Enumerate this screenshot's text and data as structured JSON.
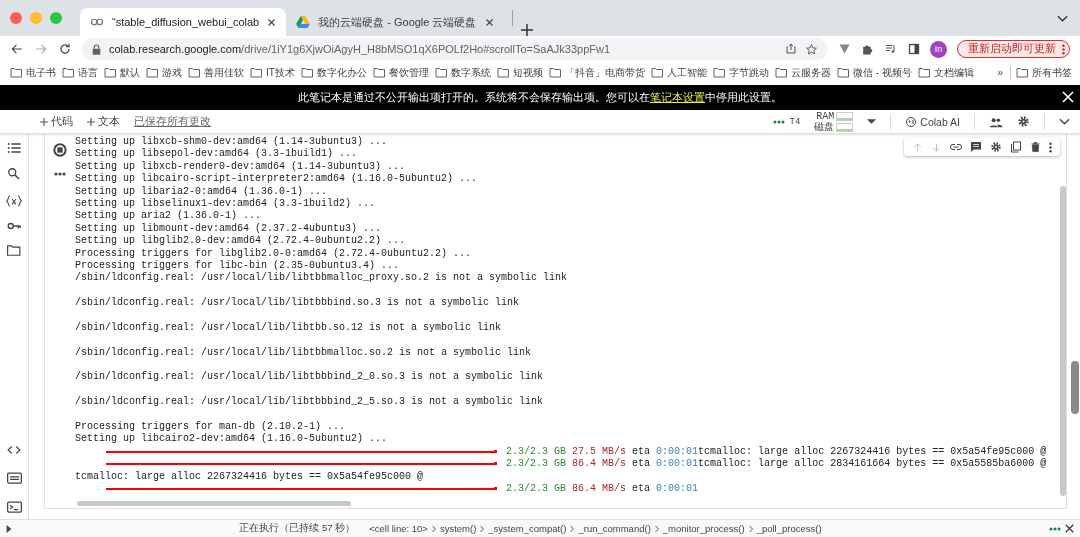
{
  "browser": {
    "tabs": [
      {
        "title": "“stable_diffusion_webui_colab",
        "selected": true
      },
      {
        "title": "我的云端硬盘 - Google 云端硬盘",
        "selected": false
      }
    ],
    "url_host": "colab.research.google.com",
    "url_path": "/drive/1iY1g6XjwOiAgyH_H8bMSO1qX6POLf2Ho#scrollTo=SaAJk33ppFw1",
    "profile_initials": "In",
    "update_button": "重新启动即可更新",
    "bookmarks": [
      "电子书",
      "语言",
      "默认",
      "游戏",
      "善用佳软",
      "IT技术",
      "数字化办公",
      "餐饮管理",
      "数字系统",
      "短视频",
      "「抖音」电商带货",
      "人工智能",
      "字节跳动",
      "云服务器",
      "微信 - 视频号",
      "文档编辑"
    ],
    "more_bookmarks": "»",
    "all_bookmarks": "所有书签"
  },
  "banner": {
    "text": "此笔记本是通过不公开输出项打开的。系统将不会保存输出项。您可以在",
    "link": "笔记本设置",
    "text_after": "中停用此设置。"
  },
  "colab_toolbar": {
    "add_code": "代码",
    "add_text": "文本",
    "save_status": "已保存所有更改",
    "runtime": "T4",
    "meters": [
      {
        "label": "RAM"
      },
      {
        "label": "磁盘"
      }
    ],
    "ai_button": "Colab AI"
  },
  "output": {
    "lines": [
      {
        "kind": "text",
        "text": "Setting up libxcb-shm0-dev:amd64 (1.14-3ubuntu3) ..."
      },
      {
        "kind": "text",
        "text": "Setting up libsepol-dev:amd64 (3.3-1build1) ..."
      },
      {
        "kind": "text",
        "text": "Setting up libxcb-render0-dev:amd64 (1.14-3ubuntu3) ..."
      },
      {
        "kind": "text",
        "text": "Setting up libcairo-script-interpreter2:amd64 (1.16.0-5ubuntu2) ..."
      },
      {
        "kind": "text",
        "text": "Setting up libaria2-0:amd64 (1.36.0-1) ..."
      },
      {
        "kind": "text",
        "text": "Setting up libselinux1-dev:amd64 (3.3-1build2) ..."
      },
      {
        "kind": "text",
        "text": "Setting up aria2 (1.36.0-1) ..."
      },
      {
        "kind": "text",
        "text": "Setting up libmount-dev:amd64 (2.37.2-4ubuntu3) ..."
      },
      {
        "kind": "text",
        "text": "Setting up libglib2.0-dev:amd64 (2.72.4-0ubuntu2.2) ..."
      },
      {
        "kind": "text",
        "text": "Processing triggers for libglib2.0-0:amd64 (2.72.4-0ubuntu2.2) ..."
      },
      {
        "kind": "text",
        "text": "Processing triggers for libc-bin (2.35-0ubuntu3.4) ..."
      },
      {
        "kind": "text",
        "text": "/sbin/ldconfig.real: /usr/local/lib/libtbbmalloc_proxy.so.2 is not a symbolic link"
      },
      {
        "kind": "blank"
      },
      {
        "kind": "text",
        "text": "/sbin/ldconfig.real: /usr/local/lib/libtbbbind.so.3 is not a symbolic link"
      },
      {
        "kind": "blank"
      },
      {
        "kind": "text",
        "text": "/sbin/ldconfig.real: /usr/local/lib/libtbb.so.12 is not a symbolic link"
      },
      {
        "kind": "blank"
      },
      {
        "kind": "text",
        "text": "/sbin/ldconfig.real: /usr/local/lib/libtbbmalloc.so.2 is not a symbolic link"
      },
      {
        "kind": "blank"
      },
      {
        "kind": "text",
        "text": "/sbin/ldconfig.real: /usr/local/lib/libtbbbind_2_0.so.3 is not a symbolic link"
      },
      {
        "kind": "blank"
      },
      {
        "kind": "text",
        "text": "/sbin/ldconfig.real: /usr/local/lib/libtbbbind_2_5.so.3 is not a symbolic link"
      },
      {
        "kind": "blank"
      },
      {
        "kind": "text",
        "text": "Processing triggers for man-db (2.10.2-1) ..."
      },
      {
        "kind": "text",
        "text": "Setting up libcairo2-dev:amd64 (1.16.0-5ubuntu2) ..."
      },
      {
        "kind": "progress",
        "size": "2.3/2.3 GB",
        "rate": "27.5 MB/s",
        "eta_label": "eta",
        "eta": "0:00:01",
        "tail": "tcmalloc: large alloc 2267324416 bytes == 0x5a54fe95c000 @"
      },
      {
        "kind": "progress",
        "size": "2.3/2.3 GB",
        "rate": "86.4 MB/s",
        "eta_label": "eta",
        "eta": "0:00:01",
        "tail": "tcmalloc: large alloc 2834161664 bytes == 0x5a5585ba6000 @"
      },
      {
        "kind": "text",
        "text": "tcmalloc: large alloc 2267324416 bytes == 0x5a54fe95c000 @"
      },
      {
        "kind": "progress",
        "size": "2.3/2.3 GB",
        "rate": "86.4 MB/s",
        "eta_label": "eta",
        "eta": "0:00:01"
      }
    ]
  },
  "status_bar": {
    "running": "正在执行（已持续 57 秒）",
    "stack": [
      "<cell line: 10>",
      "system()",
      "_system_compat()",
      "_run_command()",
      "_monitor_process()",
      "_poll_process()"
    ]
  }
}
